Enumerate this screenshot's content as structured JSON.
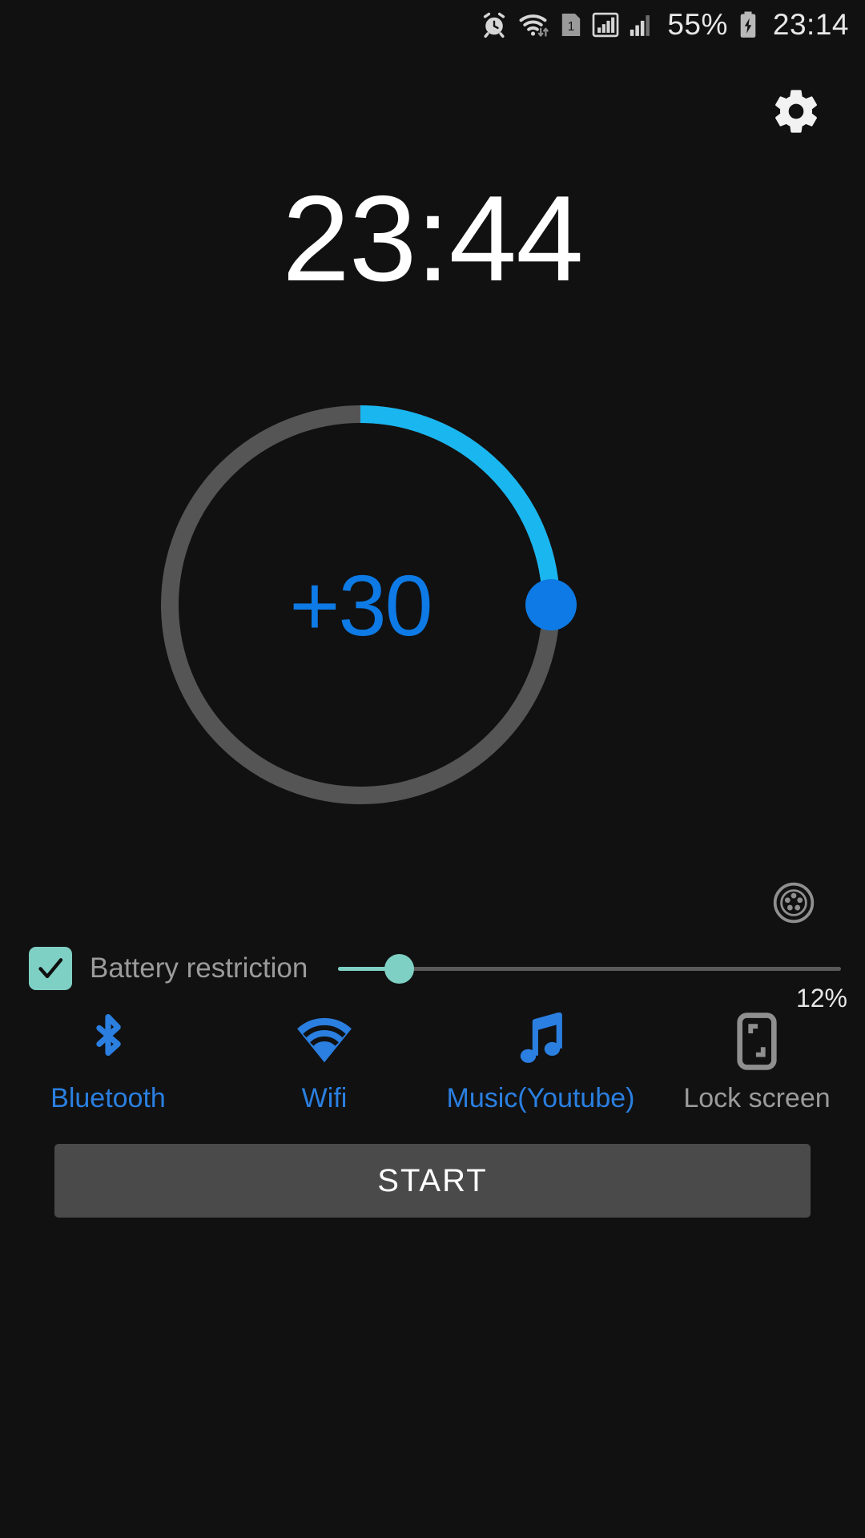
{
  "statusbar": {
    "icons": [
      "alarm-icon",
      "wifi-icon",
      "sim-1-icon",
      "signal-1-icon",
      "signal-2-icon"
    ],
    "sim_badge": "1",
    "battery_percent": "55%",
    "battery_state": "charging",
    "clock": "23:14"
  },
  "header": {
    "settings_icon": "gear-icon"
  },
  "timer": {
    "target_time": "23:44",
    "dial_value": "+30",
    "dial_unit": "minutes",
    "progress_percent": 25,
    "track_color": "#555555",
    "progress_color": "#1ab6f0",
    "knob_color": "#0d7ae5",
    "value_color": "#0d7ae5",
    "preset_icon": "preset-dial-icon"
  },
  "battery": {
    "checkbox_checked": true,
    "checkbox_color": "#7fd0c4",
    "label": "Battery restriction",
    "slider_value": 12,
    "slider_display": "12%",
    "slider_color": "#7fd0c4",
    "track_color": "#5a5a5a"
  },
  "toggles": [
    {
      "icon": "bluetooth-icon",
      "label": "Bluetooth",
      "active": true
    },
    {
      "icon": "wifi-icon",
      "label": "Wifi",
      "active": true
    },
    {
      "icon": "music-note-icon",
      "label": "Music(Youtube)",
      "active": true
    },
    {
      "icon": "lock-screen-icon",
      "label": "Lock screen",
      "active": false
    }
  ],
  "actions": {
    "start_label": "START",
    "start_bg": "#4a4a4a"
  }
}
